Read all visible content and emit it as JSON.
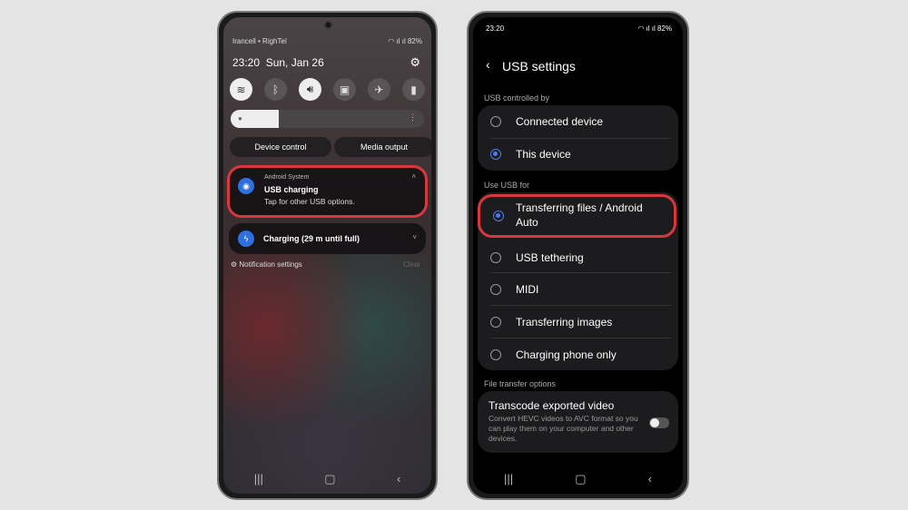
{
  "left": {
    "carrier": "Irancell • RighTel",
    "battery": "82%",
    "time": "23:20",
    "date": "Sun, Jan 26",
    "quick_settings": [
      "wifi-icon",
      "bluetooth-icon",
      "sound-icon",
      "lock-icon",
      "airplane-icon",
      "flashlight-icon"
    ],
    "brightness": 0.25,
    "device_control": "Device control",
    "media_output": "Media output",
    "notification": {
      "app": "Android System",
      "title": "USB charging",
      "text": "Tap for other USB options."
    },
    "charging": "Charging (29 m until full)",
    "notification_settings": "Notification settings",
    "clear": "Clear"
  },
  "right": {
    "time": "23:20",
    "battery": "82%",
    "title": "USB settings",
    "section1": "USB controlled by",
    "controlled_by": [
      {
        "label": "Connected device",
        "selected": false
      },
      {
        "label": "This device",
        "selected": true
      }
    ],
    "section2": "Use USB for",
    "use_for": [
      {
        "label": "Transferring files / Android Auto",
        "selected": true
      },
      {
        "label": "USB tethering",
        "selected": false
      },
      {
        "label": "MIDI",
        "selected": false
      },
      {
        "label": "Transferring images",
        "selected": false
      },
      {
        "label": "Charging phone only",
        "selected": false
      }
    ],
    "section3": "File transfer options",
    "transcode": {
      "title": "Transcode exported video",
      "desc": "Convert HEVC videos to AVC format so you can play them on your computer and other devices.",
      "enabled": false
    }
  },
  "colors": {
    "highlight": "#d9363e",
    "accent": "#4a7cf0"
  }
}
